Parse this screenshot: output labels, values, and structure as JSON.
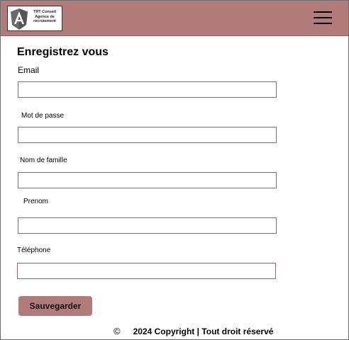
{
  "header": {
    "logo_lines": [
      "TRT Conseil",
      "Agence de",
      "recrutement"
    ],
    "menu_icon": "hamburger-menu-icon",
    "background_color": "#b17b79"
  },
  "form": {
    "title": "Enregistrez vous",
    "fields": {
      "email": {
        "label": "Email",
        "value": "",
        "placeholder": ""
      },
      "password": {
        "label": "Mot de passe",
        "value": "",
        "placeholder": ""
      },
      "lastname": {
        "label": "Nom de famille",
        "value": "",
        "placeholder": ""
      },
      "firstname": {
        "label": "Prenom",
        "value": "",
        "placeholder": ""
      },
      "phone": {
        "label": "Téléphone",
        "value": "",
        "placeholder": ""
      }
    },
    "submit_label": "Sauvegarder"
  },
  "footer": {
    "copyright_symbol": "©",
    "text": "2024 Copyright | Tout droit réservé"
  }
}
